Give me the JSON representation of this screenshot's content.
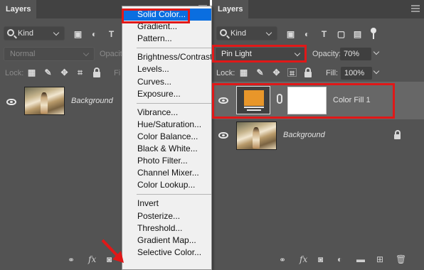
{
  "left_panel": {
    "tab_title": "Layers",
    "filter_kind": "Kind",
    "blend_mode": "Normal",
    "opacity_label": "Opacity:",
    "lock_label": "Lock:",
    "fill_label": "Fi",
    "layer": {
      "name": "Background"
    }
  },
  "right_panel": {
    "tab_title": "Layers",
    "filter_kind": "Kind",
    "blend_mode": "Pin Light",
    "opacity_label": "Opacity:",
    "opacity_value": "70%",
    "lock_label": "Lock:",
    "fill_label": "Fill:",
    "fill_value": "100%",
    "layers": [
      {
        "name": "Color Fill 1",
        "fill_color": "#e8962a"
      },
      {
        "name": "Background"
      }
    ]
  },
  "adjustment_menu": {
    "groups": [
      [
        "Solid Color...",
        "Gradient...",
        "Pattern..."
      ],
      [
        "Brightness/Contrast...",
        "Levels...",
        "Curves...",
        "Exposure..."
      ],
      [
        "Vibrance...",
        "Hue/Saturation...",
        "Color Balance...",
        "Black & White...",
        "Photo Filter...",
        "Channel Mixer...",
        "Color Lookup..."
      ],
      [
        "Invert",
        "Posterize...",
        "Threshold...",
        "Gradient Map...",
        "Selective Color..."
      ]
    ],
    "highlighted": "Solid Color..."
  },
  "colors": {
    "panel_bg": "#535353",
    "menu_highlight": "#0a6ee0",
    "annotation_red": "#e01818",
    "fill_color": "#e8962a"
  }
}
